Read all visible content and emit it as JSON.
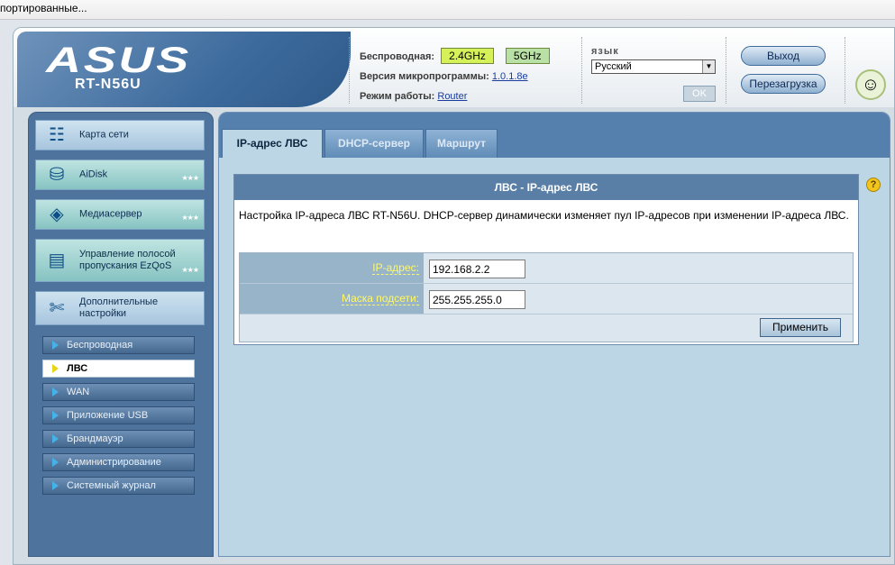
{
  "browser": {
    "bookmark_text": "портированные..."
  },
  "header": {
    "brand": "ASUS",
    "model": "RT-N56U",
    "wireless_label": "Беспроводная:",
    "band_24": "2.4GHz",
    "band_5": "5GHz",
    "firmware_label": "Версия микропрограммы:",
    "firmware_value": "1.0.1.8e",
    "mode_label": "Режим работы:",
    "mode_value": "Router",
    "language_label": "язык",
    "language_value": "Русский",
    "ok_label": "OK",
    "logout_label": "Выход",
    "reboot_label": "Перезагрузка"
  },
  "sidebar": {
    "main_items": [
      {
        "label": "Карта сети",
        "icon": "network-map-icon"
      },
      {
        "label": "AiDisk",
        "icon": "disk-icon"
      },
      {
        "label": "Медиасервер",
        "icon": "media-server-icon"
      },
      {
        "label": "Управление полосой пропускания EzQoS",
        "icon": "qos-icon"
      },
      {
        "label": "Дополнительные настройки",
        "icon": "tools-icon"
      }
    ],
    "sub_items": [
      {
        "label": "Беспроводная"
      },
      {
        "label": "ЛВС"
      },
      {
        "label": "WAN"
      },
      {
        "label": "Приложение USB"
      },
      {
        "label": "Брандмауэр"
      },
      {
        "label": "Администрирование"
      },
      {
        "label": "Системный журнал"
      }
    ],
    "active_sub": "ЛВС"
  },
  "tabs": [
    {
      "label": "IP-адрес ЛВС",
      "active": true
    },
    {
      "label": "DHCP-сервер",
      "active": false
    },
    {
      "label": "Маршрут",
      "active": false
    }
  ],
  "panel": {
    "title": "ЛВС - IP-адрес ЛВС",
    "description": "Настройка IP-адреса ЛВС RT-N56U. DHCP-сервер динамически изменяет пул IP-адресов при изменении IP-адреса ЛВС.",
    "ip_label": "IP-адрес:",
    "ip_value": "192.168.2.2",
    "mask_label": "Маска подсети:",
    "mask_value": "255.255.255.0",
    "apply_label": "Применить"
  },
  "colors": {
    "accent": "#5580ad",
    "band_24_bg": "#d6f05a",
    "band_5_bg": "#b9e0a5",
    "label_text": "#fff86a"
  }
}
